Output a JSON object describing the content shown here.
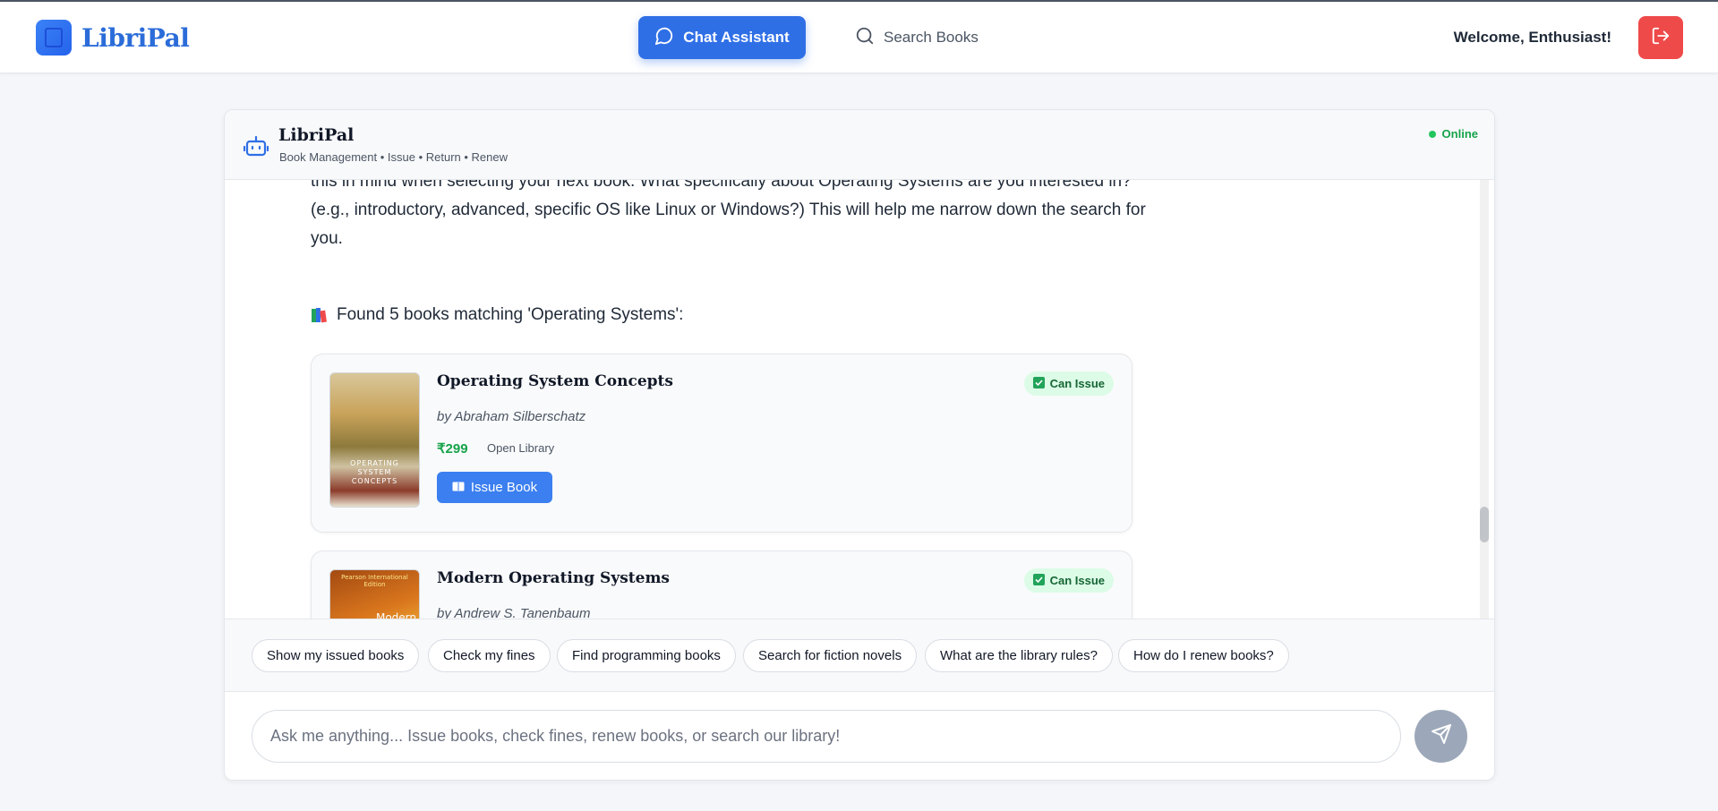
{
  "app": {
    "name": "LibriPal",
    "logo_icon": "book-icon"
  },
  "nav": {
    "chat_label": "Chat Assistant",
    "search_label": "Search Books",
    "active": "Chat Assistant"
  },
  "user": {
    "welcome": "Welcome, Enthusiast!",
    "logout_icon": "logout-icon"
  },
  "colors": {
    "accent": "#2f6fe6",
    "logout": "#ef4a4a",
    "online": "#22c55e",
    "price": "#16a34a"
  },
  "chat": {
    "title": "LibriPal",
    "subtitle": "Book Management • Issue • Return • Renew",
    "status": "Online",
    "message_text": "this in mind when selecting your next book. What specifically about Operating Systems are you interested in? (e.g., introductory, advanced, specific OS like Linux or Windows?) This will help me narrow down the search for you.",
    "found_text": "Found 5 books matching 'Operating Systems':",
    "books": [
      {
        "title": "Operating System Concepts",
        "author": "by Abraham Silberschatz",
        "price": "₹299",
        "source": "Open Library",
        "badge": "Can Issue",
        "action": "Issue Book"
      },
      {
        "title": "Modern Operating Systems",
        "author": "by Andrew S. Tanenbaum",
        "badge": "Can Issue",
        "cover_badge": "Pearson International Edition",
        "cover_word": "Modern"
      }
    ]
  },
  "suggestions": [
    "Show my issued books",
    "Check my fines",
    "Find programming books",
    "Search for fiction novels",
    "What are the library rules?",
    "How do I renew books?"
  ],
  "input": {
    "placeholder": "Ask me anything... Issue books, check fines, renew books, or search our library!"
  }
}
